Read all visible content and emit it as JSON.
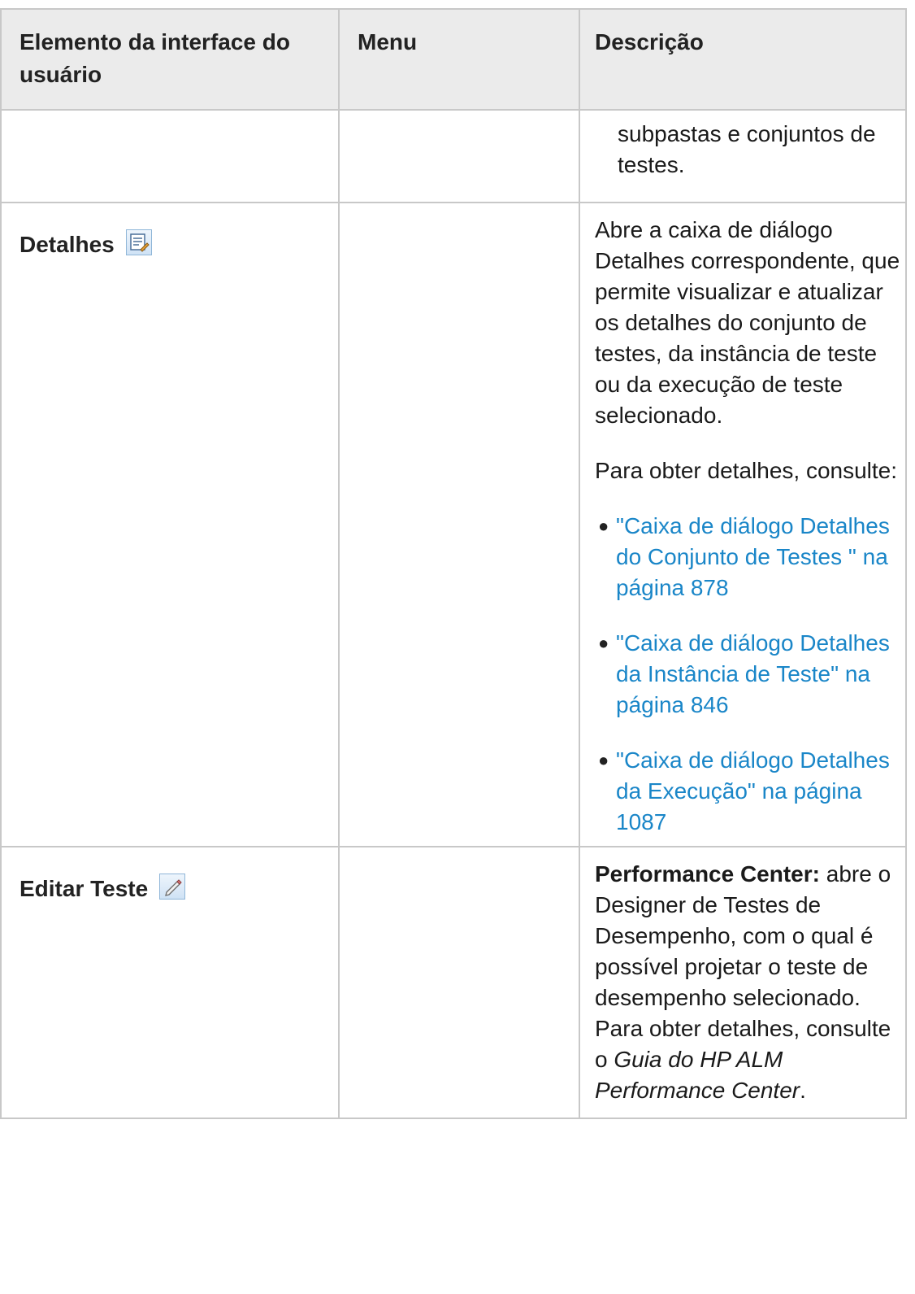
{
  "table": {
    "headers": {
      "col1": "Elemento da interface do usuário",
      "col2": "Menu",
      "col3": "Descrição"
    },
    "rows": [
      {
        "element": "",
        "menu": "",
        "description": "subpastas e conjuntos de testes."
      },
      {
        "element": "Detalhes",
        "icon": "details-icon",
        "menu": "",
        "description_p1": "Abre a caixa de diálogo Detalhes correspondente, que permite visualizar e atualizar os detalhes do conjunto de testes, da instância de teste ou da execução de teste selecionado.",
        "description_p2": "Para obter detalhes, consulte:",
        "links": [
          "\"Caixa de diálogo Detalhes do Conjunto de Testes \" na página 878",
          "\"Caixa de diálogo Detalhes da Instância de Teste\" na página 846",
          "\"Caixa de diálogo Detalhes da Execução\" na página 1087"
        ]
      },
      {
        "element": "Editar Teste",
        "icon": "pencil-icon",
        "menu": "",
        "desc_bold": "Performance Center:",
        "desc_text": " abre o Designer de Testes de Desempenho, com o qual é possível projetar o teste de desempenho selecionado. Para obter detalhes, consulte o ",
        "desc_italic": "Guia do HP ALM Performance Center",
        "desc_end": "."
      }
    ]
  },
  "colors": {
    "link": "#1a86c8",
    "header_bg": "#ebebeb",
    "border": "#c8c8c8"
  }
}
